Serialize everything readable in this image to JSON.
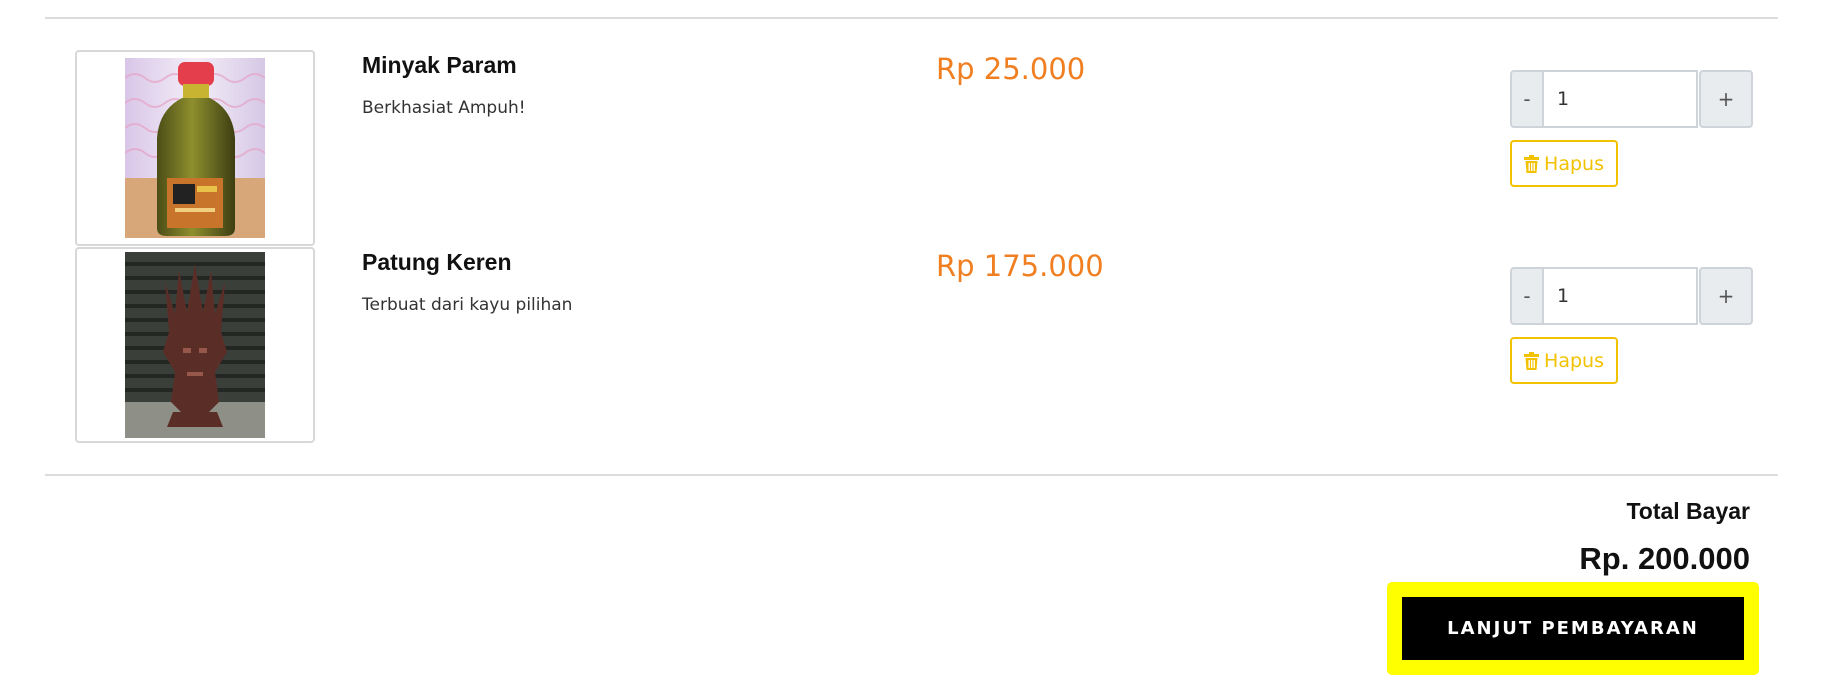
{
  "cart": {
    "items": [
      {
        "name": "Minyak Param",
        "description": "Berkhasiat Ampuh!",
        "price": "Rp 25.000",
        "quantity": "1",
        "image_icon": "oil-bottle-photo"
      },
      {
        "name": "Patung Keren",
        "description": "Terbuat dari kayu pilihan",
        "price": "Rp 175.000",
        "quantity": "1",
        "image_icon": "wood-statue-photo"
      }
    ],
    "controls": {
      "decrement_label": "-",
      "increment_label": "+",
      "delete_label": "Hapus",
      "delete_icon": "trash-icon"
    }
  },
  "summary": {
    "total_label": "Total Bayar",
    "total_value": "Rp. 200.000"
  },
  "checkout": {
    "button_label": "LANJUT PEMBAYARAN"
  },
  "colors": {
    "price": "#f07f22",
    "delete_accent": "#f2c200",
    "checkout_background": "#000000",
    "highlight": "#ffff00"
  }
}
